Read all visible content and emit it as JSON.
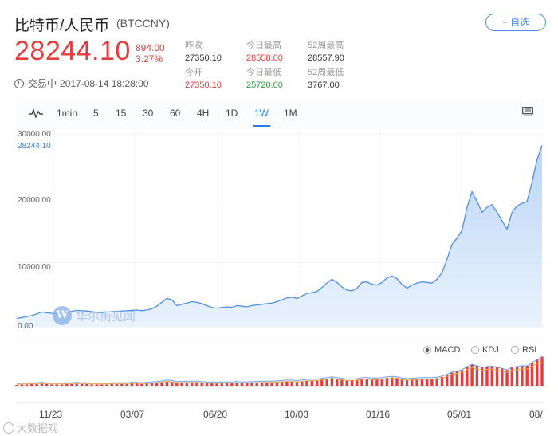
{
  "header": {
    "title": "比特币/人民币",
    "code": "(BTCCNY)",
    "fav_label": "+ 自选",
    "price": "28244.10",
    "change": "894.00",
    "change_pct": "3.27%",
    "status_label": "交易中",
    "status_time": "2017-08-14 18:28:00"
  },
  "stats": [
    {
      "label": "昨收",
      "value": "27350.10",
      "tone": "dark"
    },
    {
      "label": "今日最高",
      "value": "28558.00",
      "tone": "red"
    },
    {
      "label": "52周最高",
      "value": "28557.90",
      "tone": "dark"
    },
    {
      "label": "今开",
      "value": "27350.10",
      "tone": "red"
    },
    {
      "label": "今日最低",
      "value": "25720.00",
      "tone": "green"
    },
    {
      "label": "52周最低",
      "value": "3767.00",
      "tone": "dark"
    }
  ],
  "toolbar": {
    "items": [
      "1min",
      "15",
      "30",
      "60",
      "4H",
      "1D",
      "1W",
      "1M"
    ],
    "plain_items": [
      "5"
    ],
    "active": "1W",
    "line_icon": "line-chart-icon",
    "monitor_icon": "monitor-icon"
  },
  "indicators": {
    "options": [
      "MACD",
      "KDJ",
      "RSI"
    ],
    "selected": "MACD"
  },
  "watermark": {
    "logo": "W",
    "text": "华尔街见闻"
  },
  "corner_watermark": "大数据观",
  "colors": {
    "accent": "#2f7be5",
    "up": "#e33c3c",
    "down": "#2a9d3c",
    "area": "#d6e6fb"
  },
  "chart_data": {
    "type": "area",
    "current_label": "28244.10",
    "y_ticks": [
      "30000.00",
      "20000.00",
      "10000.00",
      "0.00"
    ],
    "ylim": [
      0,
      30000
    ],
    "x_ticks": [
      "11/23",
      "03/07",
      "06/20",
      "10/03",
      "01/16",
      "05/01",
      "08/"
    ],
    "values": [
      1300,
      1450,
      1600,
      1750,
      2000,
      2300,
      2200,
      2100,
      2050,
      2150,
      2300,
      2400,
      2550,
      2500,
      2450,
      2350,
      2250,
      2200,
      2300,
      2350,
      2400,
      2450,
      2500,
      2550,
      2600,
      2500,
      2600,
      2800,
      3200,
      3800,
      4400,
      4200,
      3300,
      3500,
      3700,
      3900,
      3800,
      3600,
      3300,
      3000,
      2900,
      3000,
      3100,
      3000,
      3300,
      3200,
      3100,
      3300,
      3400,
      3500,
      3600,
      3700,
      3900,
      4200,
      4500,
      4600,
      4400,
      4800,
      5200,
      5300,
      5500,
      6100,
      6800,
      7400,
      6900,
      6200,
      5700,
      5600,
      6000,
      6900,
      7000,
      6600,
      6500,
      6900,
      7600,
      7900,
      7500,
      6600,
      6000,
      6500,
      6800,
      7000,
      6900,
      6800,
      7400,
      8400,
      10500,
      12800,
      13800,
      15000,
      18600,
      21000,
      19500,
      17800,
      18600,
      19000,
      17800,
      16500,
      15200,
      17800,
      18800,
      19200,
      19500,
      22500,
      26000,
      28244
    ],
    "macd": [
      0.2,
      0.3,
      0.3,
      0.4,
      0.4,
      0.5,
      0.4,
      0.3,
      0.3,
      0.3,
      0.4,
      0.4,
      0.5,
      0.4,
      0.4,
      0.3,
      0.3,
      0.3,
      0.3,
      0.4,
      0.4,
      0.4,
      0.4,
      0.5,
      0.5,
      0.4,
      0.5,
      0.6,
      0.7,
      0.9,
      1.1,
      1.0,
      0.7,
      0.7,
      0.8,
      0.8,
      0.8,
      0.7,
      0.6,
      0.6,
      0.5,
      0.6,
      0.6,
      0.6,
      0.7,
      0.6,
      0.6,
      0.7,
      0.7,
      0.8,
      0.8,
      0.8,
      0.9,
      1.0,
      1.1,
      1.1,
      1.0,
      1.1,
      1.3,
      1.3,
      1.4,
      1.6,
      1.8,
      2.0,
      1.8,
      1.6,
      1.4,
      1.4,
      1.5,
      1.8,
      1.8,
      1.7,
      1.7,
      1.8,
      2.0,
      2.1,
      2.0,
      1.7,
      1.5,
      1.6,
      1.7,
      1.8,
      1.8,
      1.8,
      1.9,
      2.2,
      2.7,
      3.3,
      3.6,
      3.9,
      4.8,
      5.4,
      5.0,
      4.6,
      4.8,
      4.9,
      4.6,
      4.3,
      3.9,
      4.6,
      4.8,
      5.0,
      5.0,
      5.8,
      6.7,
      7.3
    ]
  }
}
